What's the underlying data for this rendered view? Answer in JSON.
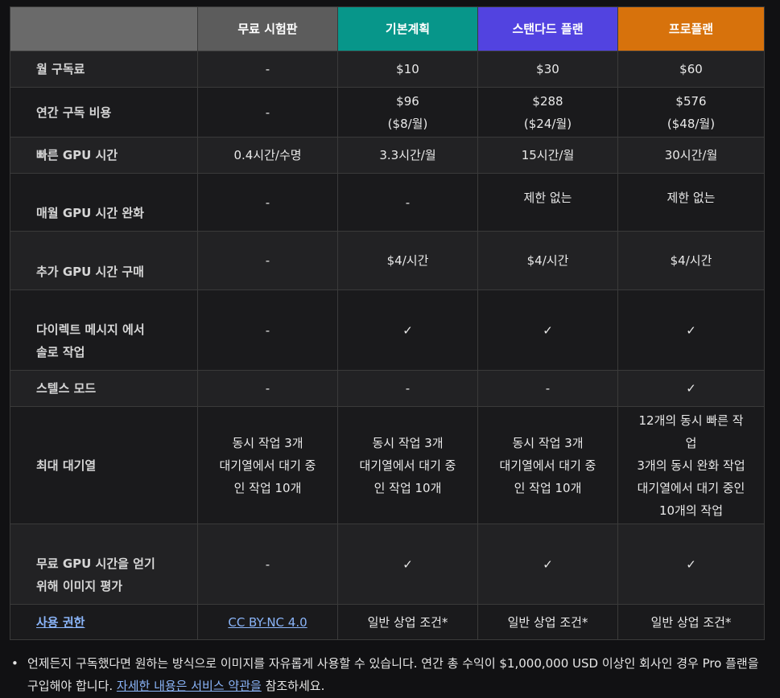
{
  "header": {
    "corner": "",
    "free": "무료 시험판",
    "basic": "기본계획",
    "standard": "스탠다드 플랜",
    "pro": "프로플랜"
  },
  "rows": {
    "monthly_fee": {
      "label": "월 구독료",
      "free": "-",
      "basic": "$10",
      "standard": "$30",
      "pro": "$60"
    },
    "annual_cost": {
      "label": "연간 구독 비용",
      "free": "-",
      "basic": "$96",
      "basic_sub": "($8/월)",
      "standard": "$288",
      "standard_sub": "($24/월)",
      "pro": "$576",
      "pro_sub": "($48/월)"
    },
    "fast_gpu": {
      "label": "빠른 GPU 시간",
      "free": "0.4시간/수명",
      "basic": "3.3시간/월",
      "standard": "15시간/월",
      "pro": "30시간/월"
    },
    "relax_gpu": {
      "label": "매월 GPU 시간 완화",
      "free": "-",
      "basic": "-",
      "standard": "제한 없는",
      "pro": "제한 없는"
    },
    "extra_gpu": {
      "label": "추가 GPU 시간 구매",
      "free": "-",
      "basic": "$4/시간",
      "standard": "$4/시간",
      "pro": "$4/시간"
    },
    "dm_solo": {
      "label_1": "다이렉트 메시지 에서",
      "label_2": "솔로 작업",
      "free": "-",
      "basic": "✓",
      "standard": "✓",
      "pro": "✓"
    },
    "stealth": {
      "label": "스텔스 모드",
      "free": "-",
      "basic": "-",
      "standard": "-",
      "pro": "✓"
    },
    "max_queue": {
      "label": "최대 대기열",
      "free": [
        "동시 작업 3개",
        "대기열에서 대기 중",
        "인 작업 10개"
      ],
      "basic": [
        "동시 작업 3개",
        "대기열에서 대기 중",
        "인 작업 10개"
      ],
      "standard": [
        "동시 작업 3개",
        "대기열에서 대기 중",
        "인 작업 10개"
      ],
      "pro": [
        "12개의 동시 빠른 작",
        "업",
        "3개의 동시 완화 작업",
        "대기열에서 대기 중인",
        "10개의 작업"
      ]
    },
    "rate_images": {
      "label_1": "무료 GPU 시간을 얻기",
      "label_2": "위해 이미지 평가",
      "free": "-",
      "basic": "✓",
      "standard": "✓",
      "pro": "✓"
    },
    "usage_rights": {
      "label": "사용 권한",
      "free": "CC BY-NC 4.0",
      "basic": "일반 상업 조건*",
      "standard": "일반 상업 조건*",
      "pro": "일반 상업 조건*"
    }
  },
  "footnote": {
    "bullet": "•",
    "text_before": "언제든지 구독했다면 원하는 방식으로 이미지를 자유롭게 사용할 수 있습니다. 연간 총 수익이 $1,000,000 USD 이상인 회사인 경우 Pro 플랜을 구입해야 합니다. ",
    "link": "자세한 내용은 서비스 약관을",
    "text_after": " 참조하세요."
  },
  "colors": {
    "free_header": "#5c5c5c",
    "basic_header": "#07968a",
    "standard_header": "#5243e0",
    "pro_header": "#d7720c",
    "link": "#8ab4f8"
  }
}
